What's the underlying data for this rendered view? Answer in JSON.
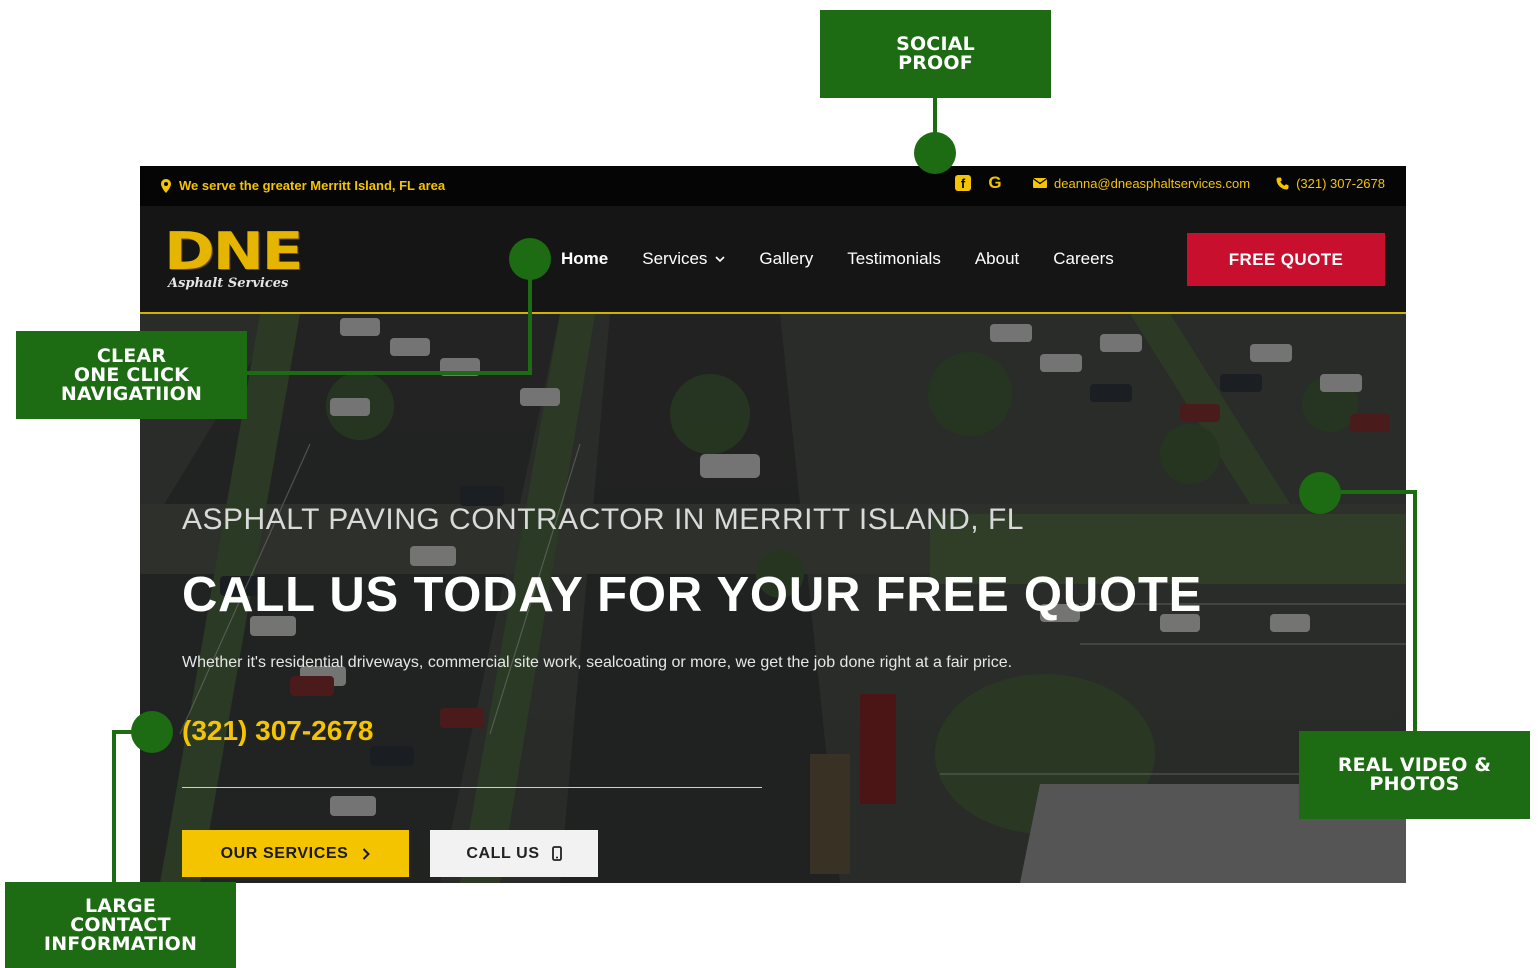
{
  "colors": {
    "callout_green": "#1d6b12",
    "brand_yellow": "#f5c400",
    "quote_red": "#c8102e",
    "topbar_bg": "#050505",
    "nav_bg": "#151515"
  },
  "callouts": {
    "social_proof": "SOCIAL\nPROOF",
    "navigation": "CLEAR\nONE CLICK\nNAVIGATIION",
    "real_media": "REAL VIDEO &\nPHOTOS",
    "contact_info": "LARGE\nCONTACT\nINFORMATION"
  },
  "topbar": {
    "location": "We serve the greater Merritt Island, FL area",
    "location_icon": "map-pin-icon",
    "social_icons": [
      "facebook-icon",
      "google-icon"
    ],
    "email": "deanna@dneasphaltservices.com",
    "email_icon": "envelope-icon",
    "phone": "(321) 307-2678",
    "phone_icon": "phone-icon"
  },
  "logo": {
    "main": "DNE",
    "sub": "Asphalt Services"
  },
  "nav": {
    "items": [
      {
        "label": "Home",
        "active": true
      },
      {
        "label": "Services",
        "dropdown": true
      },
      {
        "label": "Gallery"
      },
      {
        "label": "Testimonials"
      },
      {
        "label": "About"
      },
      {
        "label": "Careers"
      }
    ],
    "cta": "FREE QUOTE"
  },
  "hero": {
    "subhead": "ASPHALT PAVING CONTRACTOR IN MERRITT ISLAND, FL",
    "headline": "CALL US TODAY FOR YOUR FREE QUOTE",
    "description": "Whether it's residential driveways, commercial site work, sealcoating or more, we get the job done right at a fair price.",
    "phone": "(321) 307-2678",
    "primary_button": "OUR SERVICES",
    "primary_button_icon": "chevron-right-icon",
    "secondary_button": "CALL US",
    "secondary_button_icon": "mobile-phone-icon"
  }
}
